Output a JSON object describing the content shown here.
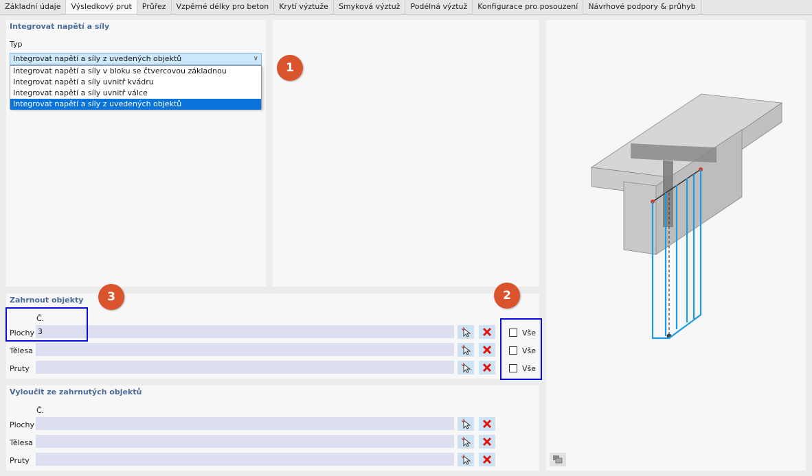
{
  "tabs": [
    {
      "label": "Základní údaje"
    },
    {
      "label": "Výsledkový prut"
    },
    {
      "label": "Průřez"
    },
    {
      "label": "Vzpěrné délky pro beton"
    },
    {
      "label": "Krytí výztuže"
    },
    {
      "label": "Smyková výztuž"
    },
    {
      "label": "Podélná výztuž"
    },
    {
      "label": "Konfigurace pro posouzení"
    },
    {
      "label": "Návrhové podpory & průhyb"
    }
  ],
  "integrate": {
    "title": "Integrovat napětí a síly",
    "type_label": "Typ",
    "selected": "Integrovat napětí a síly z uvedených objektů",
    "options": [
      "Integrovat napětí a síly v bloku se čtvercovou základnou",
      "Integrovat napětí a síly uvnitř kvádru",
      "Integrovat napětí a síly uvnitř válce",
      "Integrovat napětí a síly z uvedených objektů"
    ]
  },
  "include": {
    "title": "Zahrnout objekty",
    "col_header": "Č.",
    "rows": [
      {
        "label": "Plochy",
        "value": "3",
        "all": "Vše"
      },
      {
        "label": "Tělesa",
        "value": "",
        "all": "Vše"
      },
      {
        "label": "Pruty",
        "value": "",
        "all": "Vše"
      }
    ]
  },
  "exclude": {
    "title": "Vyloučit ze zahrnutých objektů",
    "col_header": "Č.",
    "rows": [
      {
        "label": "Plochy",
        "value": ""
      },
      {
        "label": "Tělesa",
        "value": ""
      },
      {
        "label": "Pruty",
        "value": ""
      }
    ]
  },
  "badges": [
    "1",
    "2",
    "3"
  ],
  "icons": {
    "select": "select-cursor-icon",
    "delete": "delete-x-icon",
    "chevron": "chevron-down-icon",
    "view": "view-settings-icon"
  },
  "colors": {
    "badge": "#d9532c",
    "highlight_box": "#0a0ae0",
    "selected_option": "#0a74da",
    "section_title": "#4a6a9a",
    "field": "#dcdff0",
    "rebar": "#1e9be0"
  }
}
